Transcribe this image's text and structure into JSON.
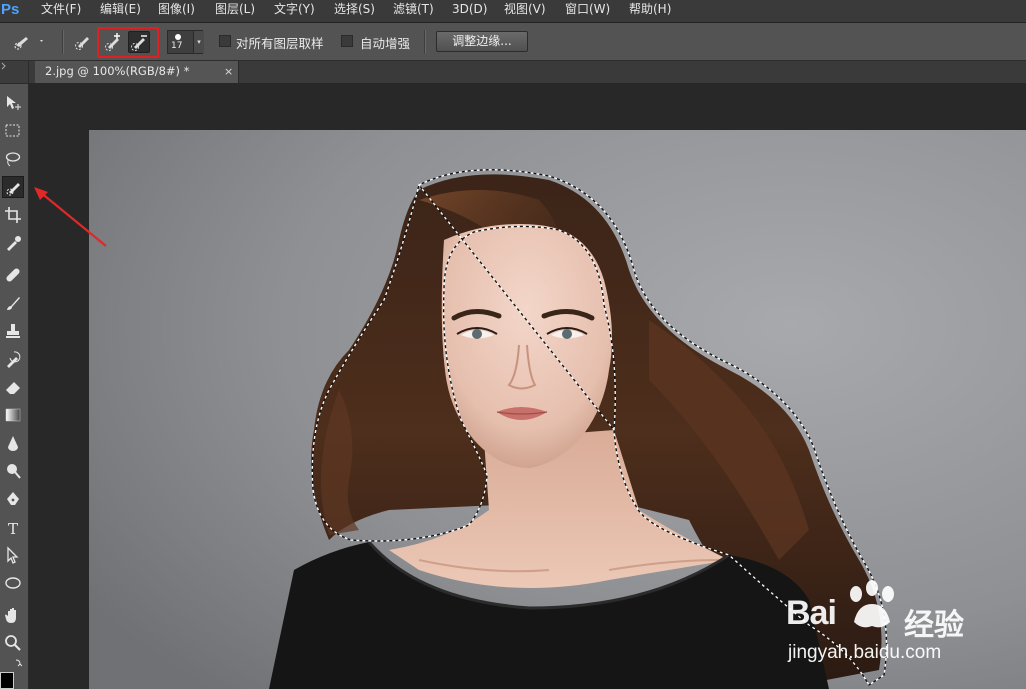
{
  "app": {
    "logo": "Ps"
  },
  "menu": [
    {
      "label": "文件(F)"
    },
    {
      "label": "编辑(E)"
    },
    {
      "label": "图像(I)"
    },
    {
      "label": "图层(L)"
    },
    {
      "label": "文字(Y)"
    },
    {
      "label": "选择(S)"
    },
    {
      "label": "滤镜(T)"
    },
    {
      "label": "3D(D)"
    },
    {
      "label": "视图(V)"
    },
    {
      "label": "窗口(W)"
    },
    {
      "label": "帮助(H)"
    }
  ],
  "options": {
    "brush_size": "17",
    "sample_all_layers_label": "对所有图层取样",
    "sample_all_layers_checked": false,
    "auto_enhance_label": "自动增强",
    "auto_enhance_checked": false,
    "refine_edge_label": "调整边缘..."
  },
  "document": {
    "tab_title": "2.jpg @ 100%(RGB/8#) *",
    "close_glyph": "×"
  },
  "watermark": {
    "brand": "Bai",
    "brand_suffix": "经验",
    "url": "jingyah.baidu.com"
  },
  "colors": {
    "highlight": "#e02020",
    "menu_bg": "#3a3a3a",
    "panel_bg": "#535353",
    "canvas_bg": "#282828",
    "accent": "#4da3ff"
  }
}
